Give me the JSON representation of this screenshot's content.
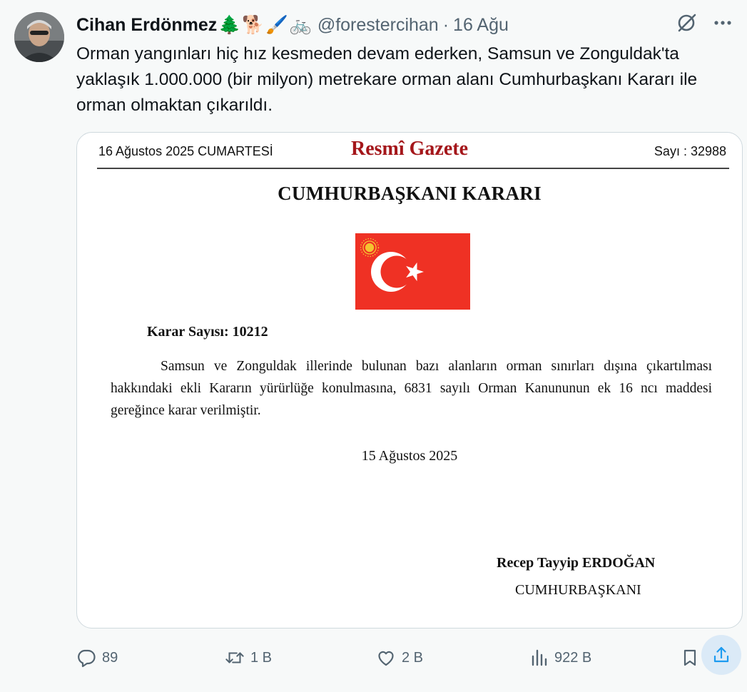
{
  "tweet": {
    "author": {
      "display_name": "Cihan Erdönmez",
      "name_emojis": [
        "🌲",
        "🐕",
        "🖌️",
        "🚲"
      ],
      "handle": "@forestercihan"
    },
    "separator": "·",
    "time": "16 Ağu",
    "text": "Orman yangınları hiç hız kesmeden devam ederken, Samsun ve Zonguldak'ta yaklaşık 1.000.000 (bir milyon) metrekare orman alanı Cumhurbaşkanı Kararı ile orman olmaktan çıkarıldı.",
    "header_icons": [
      "grok-icon",
      "more-icon"
    ]
  },
  "gazette": {
    "date": "16 Ağustos 2025 CUMARTESİ",
    "title": "Resmî Gazete",
    "issue": "Sayı : 32988",
    "heading": "CUMHURBAŞKANI KARARI",
    "decision_no": "Karar Sayısı: 10212",
    "body": "Samsun ve Zonguldak illerinde bulunan bazı alanların orman sınırları dışına çıkartılması hakkındaki ekli Kararın yürürlüğe konulmasına, 6831 sayılı Orman Kanununun ek 16 ncı maddesi gereğince karar verilmiştir.",
    "signed_date": "15 Ağustos 2025",
    "signer": "Recep Tayyip ERDOĞAN",
    "signer_title": "CUMHURBAŞKANI",
    "flag_color": "#e30a17"
  },
  "actions": {
    "reply_count": "89",
    "repost_count": "1 B",
    "like_count": "2 B",
    "views_count": "922 B"
  },
  "colors": {
    "text": "#0f1419",
    "secondary": "#536471",
    "gazette_title": "#a4161a",
    "share_highlight": "#1d9bf0"
  }
}
